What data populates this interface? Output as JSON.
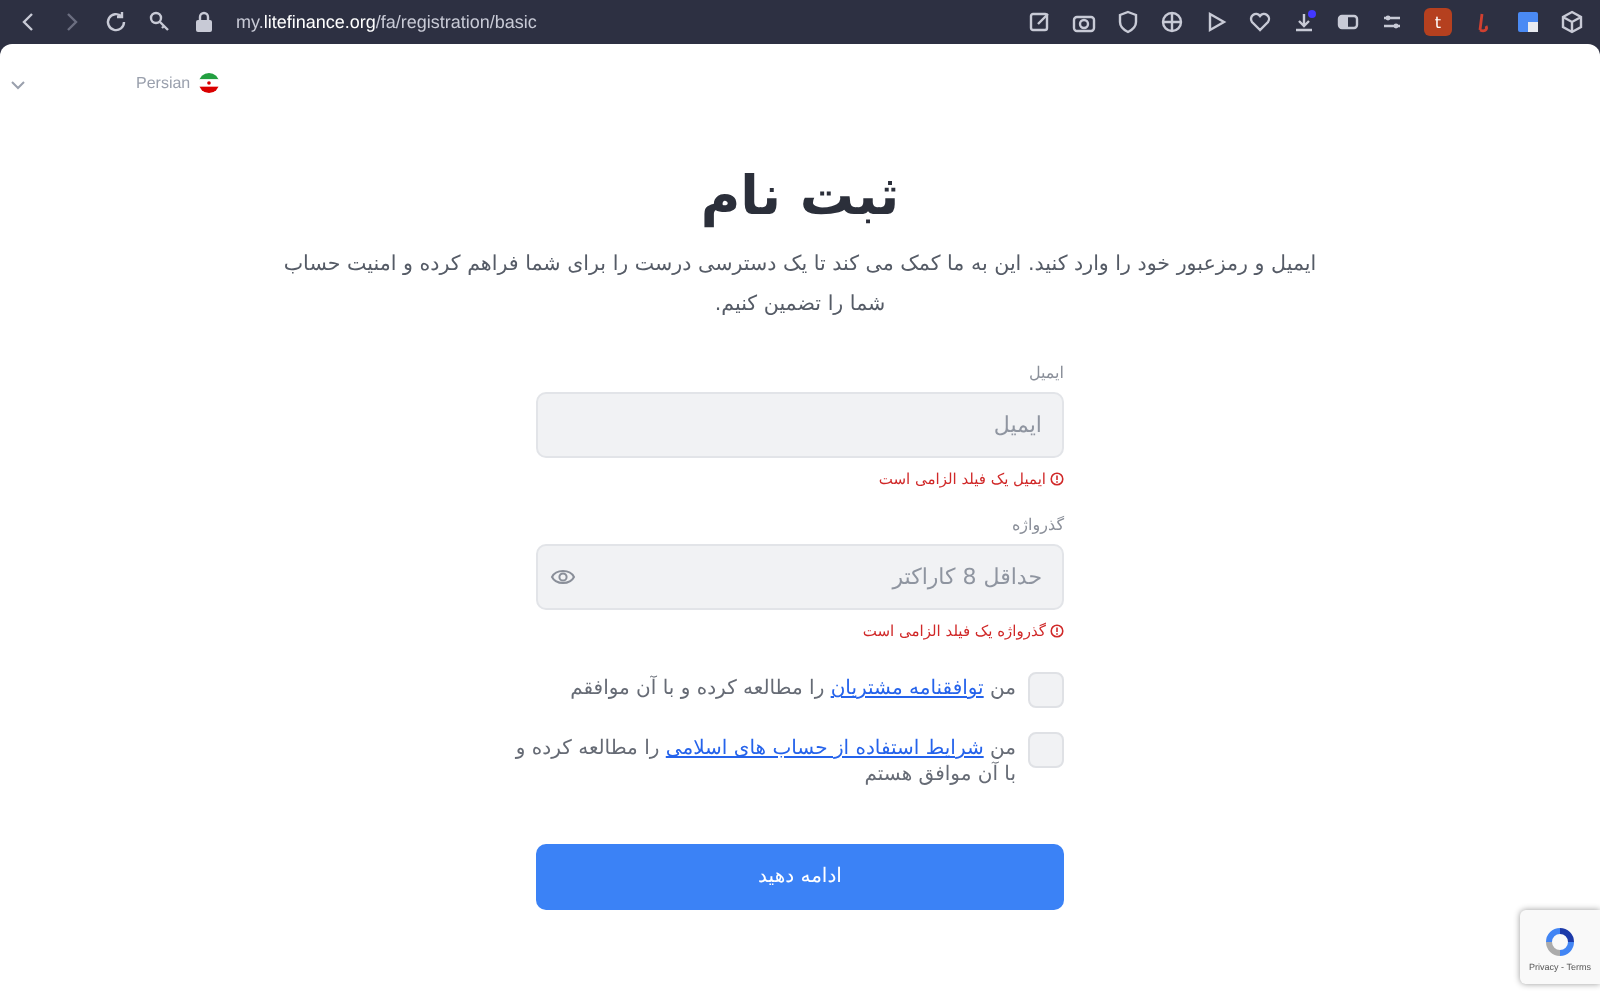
{
  "browser": {
    "url": "my.**litefinance.org**/fa/registration/basic",
    "profile": "t"
  },
  "language": {
    "label": "Persian"
  },
  "title": "ثبت نام",
  "intro": "ایمیل و رمزعبور خود را وارد کنید. این به ما کمک می کند تا یک دسترسی درست را برای شما فراهم کرده و امنیت حساب شما را تضمین کنیم.",
  "fields": [
    {
      "kind": "text",
      "label": "ایمیل",
      "placeholder": "ایمیل",
      "error": "ایمیل یک فیلد الزامی است"
    },
    {
      "kind": "password",
      "label": "گذرواژه",
      "placeholder": "حداقل 8 کاراکتر",
      "error": "گذرواژه یک فیلد الزامی است"
    }
  ],
  "agreements": [
    {
      "checked": false,
      "before": "من ",
      "link": "توافقنامه مشتریان",
      "after": " را مطالعه کرده و با آن موافقم"
    },
    {
      "checked": false,
      "before": "من ",
      "link": "شرایط استفاده از حساب های اسلامی",
      "after": " را مطالعه کرده و با آن موافق هستم"
    }
  ],
  "submit": "ادامه دهید",
  "recaptcha": {
    "links": "Privacy - Terms"
  }
}
